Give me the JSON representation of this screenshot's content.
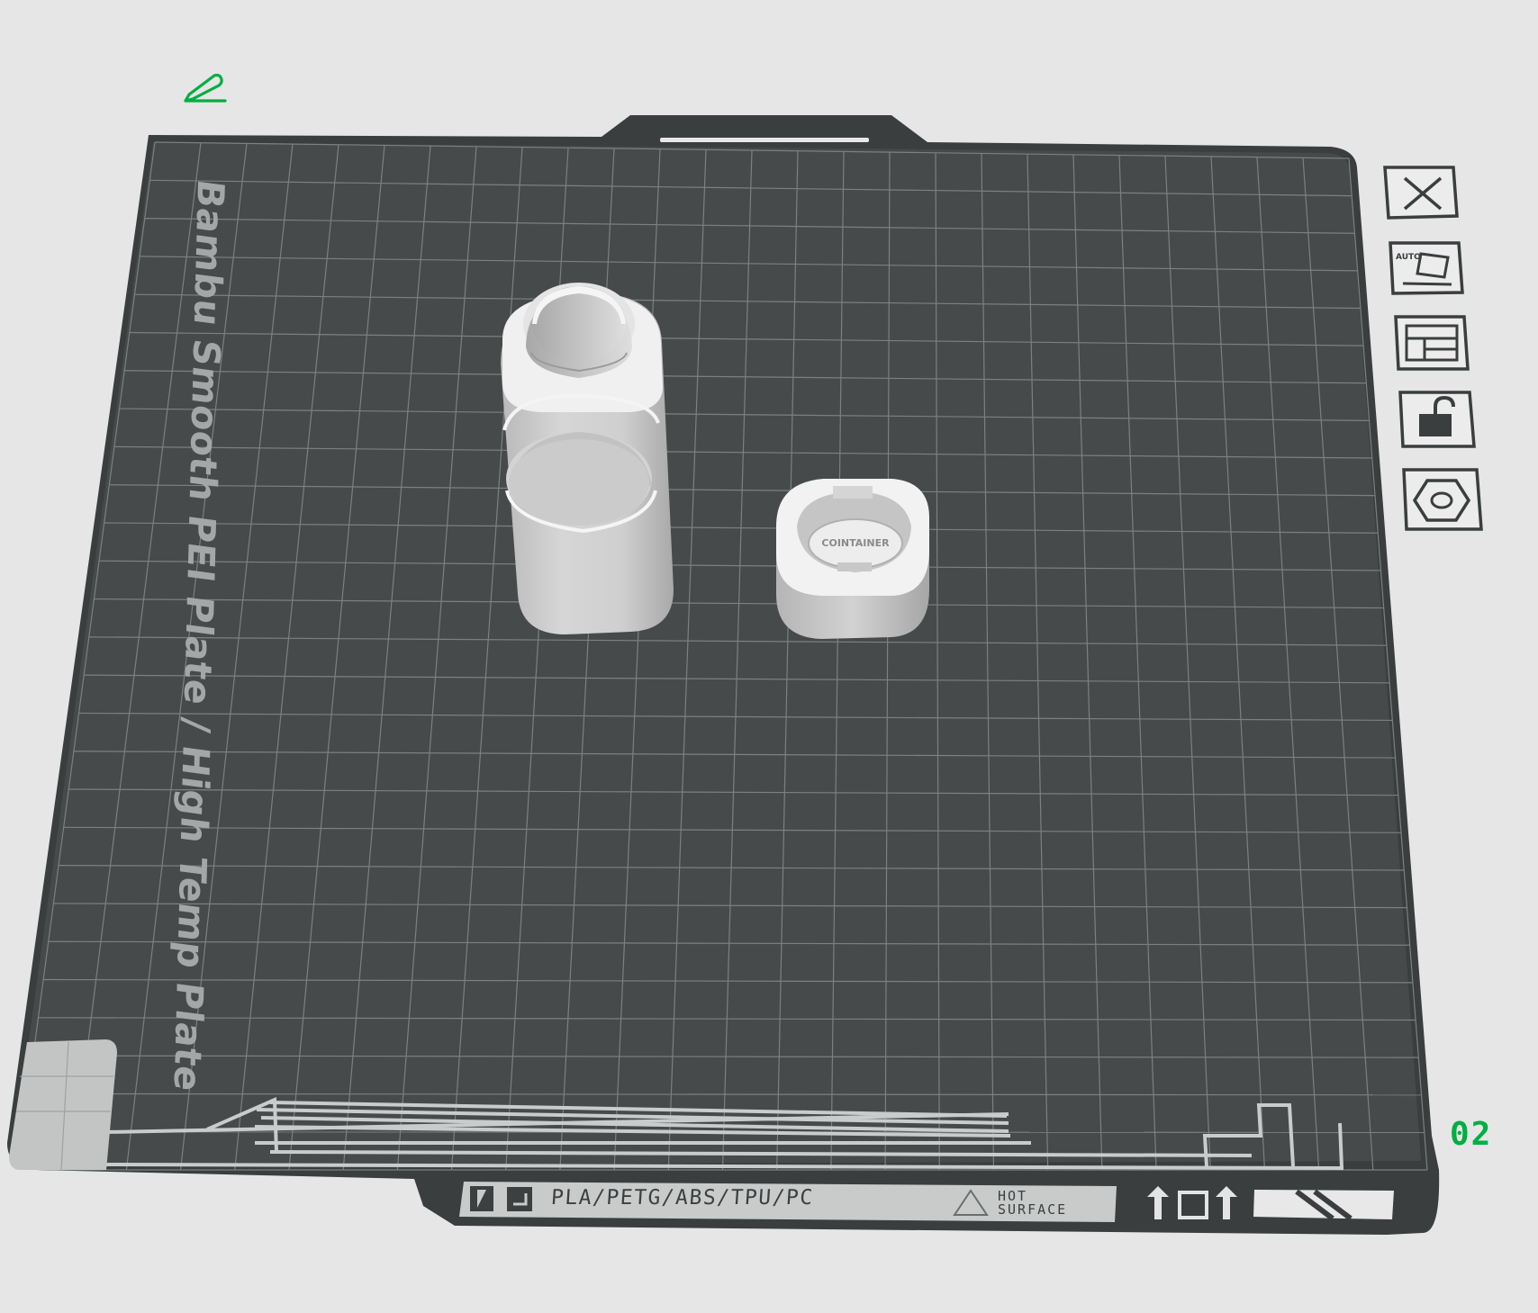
{
  "plate": {
    "name": "Bambu Smooth PEI Plate / High Temp Plate",
    "number": "02",
    "materials": "PLA/PETG/ABS/TPU/PC",
    "hot_surface_line1": "HOT",
    "hot_surface_line2": "SURFACE"
  },
  "toolbar": {
    "items": [
      {
        "name": "delete-plate",
        "icon": "close-icon"
      },
      {
        "name": "auto-orient",
        "icon": "auto-orient-icon",
        "badge": "AUTO"
      },
      {
        "name": "arrange",
        "icon": "arrange-icon"
      },
      {
        "name": "lock",
        "icon": "unlock-icon"
      },
      {
        "name": "plate-settings",
        "icon": "hexagon-nut-icon"
      }
    ]
  },
  "objects": [
    {
      "name": "tall-container",
      "type": "3d-model"
    },
    {
      "name": "cap-with-coin",
      "type": "3d-model",
      "emboss_text": "COINTAINER"
    }
  ],
  "colors": {
    "background": "#e6e6e6",
    "plate": "#454949",
    "plate_frame": "#3a3e3e",
    "grid": "#7a7e7e",
    "accent": "#00ae42",
    "model": "#d8d8d8"
  }
}
